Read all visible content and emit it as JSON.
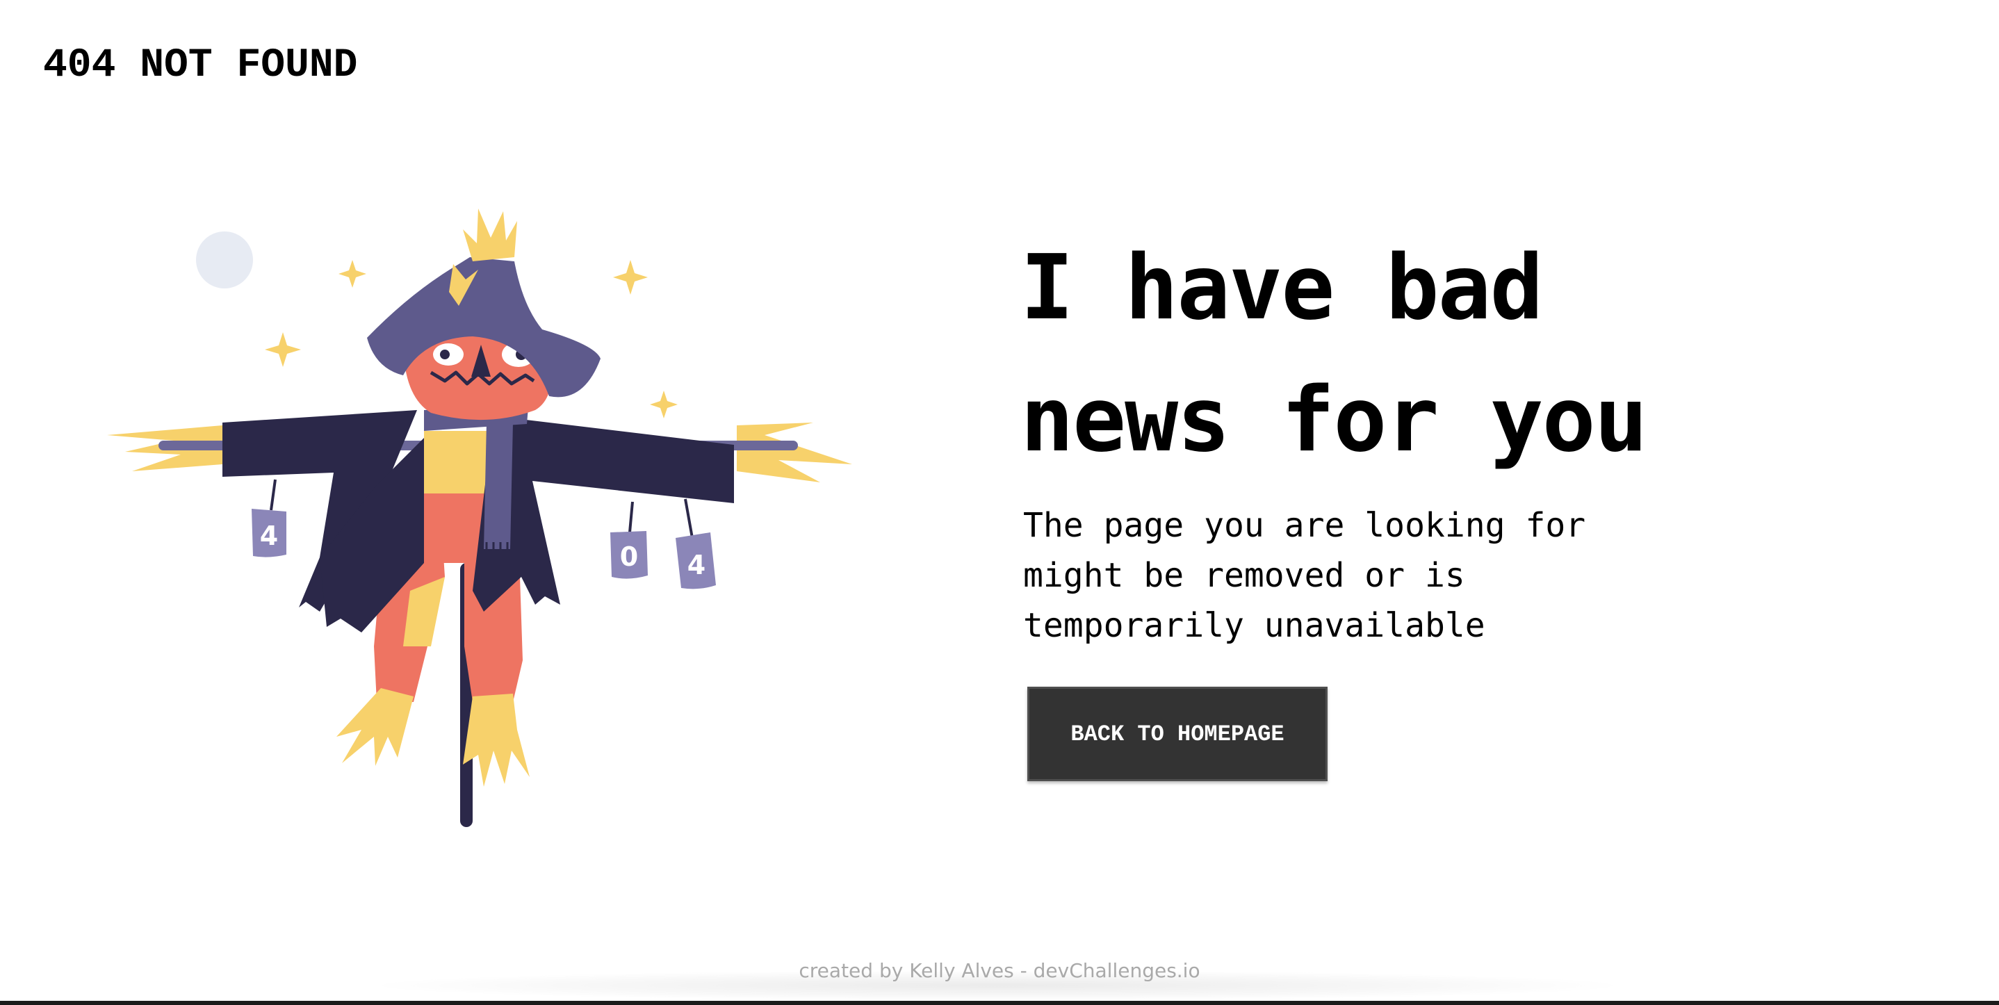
{
  "header": {
    "logo_text": "404 NOT FOUND"
  },
  "hero": {
    "headline": "I have bad news for you",
    "description": "The page you are looking for might be removed or is temporarily unavailable",
    "button_label": "BACK TO HOMEPAGE"
  },
  "illustration": {
    "can_digits": [
      "4",
      "0",
      "4"
    ],
    "colors": {
      "coat": "#2b2849",
      "hat": "#5e5a8c",
      "face": "#ee7462",
      "straw": "#f7d16b",
      "scarf": "#5e5a8c",
      "moon": "#e7ebf3",
      "cans": "#8b86b8"
    }
  },
  "footer": {
    "credit": "created by Kelly Alves - devChallenges.io"
  }
}
